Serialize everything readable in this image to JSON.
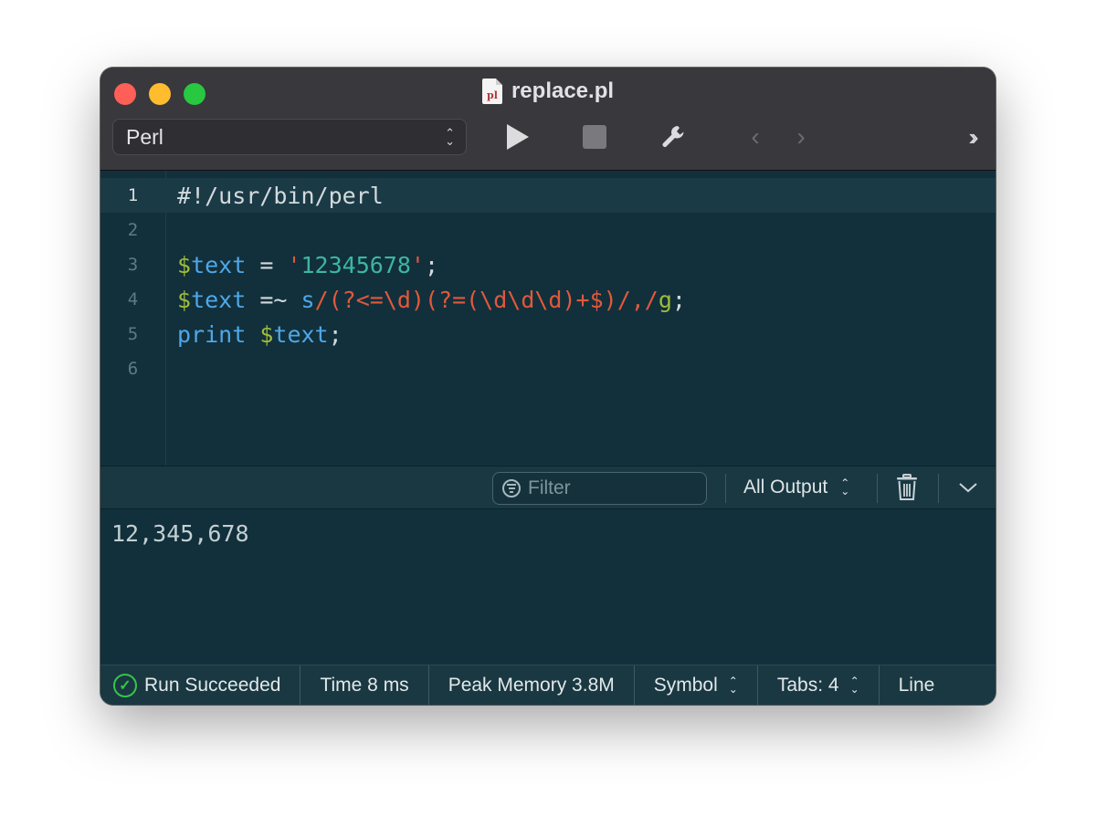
{
  "window": {
    "title": "replace.pl",
    "file_icon_label": "pl"
  },
  "toolbar": {
    "language": "Perl",
    "run_icon": "play-icon",
    "stop_icon": "stop-icon",
    "settings_icon": "wrench-icon",
    "back_icon": "chevron-left-icon",
    "forward_icon": "chevron-right-icon",
    "more_icon": "double-chevron-right-icon"
  },
  "editor": {
    "active_line": 1,
    "lines": [
      {
        "number": "1",
        "tokens": [
          {
            "text": "#!/usr/bin/perl",
            "kind": "default"
          }
        ]
      },
      {
        "number": "2",
        "tokens": []
      },
      {
        "number": "3",
        "tokens": [
          {
            "text": "$",
            "kind": "sigil"
          },
          {
            "text": "text",
            "kind": "var"
          },
          {
            "text": " = ",
            "kind": "op"
          },
          {
            "text": "'",
            "kind": "str"
          },
          {
            "text": "12345678",
            "kind": "num"
          },
          {
            "text": "'",
            "kind": "str"
          },
          {
            "text": ";",
            "kind": "op"
          }
        ]
      },
      {
        "number": "4",
        "tokens": [
          {
            "text": "$",
            "kind": "sigil"
          },
          {
            "text": "text",
            "kind": "var"
          },
          {
            "text": " =~ ",
            "kind": "op"
          },
          {
            "text": "s",
            "kind": "var"
          },
          {
            "text": "/(?<=\\d)(?=(\\d\\d\\d)+$)/,/",
            "kind": "re"
          },
          {
            "text": "g",
            "kind": "reflag"
          },
          {
            "text": ";",
            "kind": "op"
          }
        ]
      },
      {
        "number": "5",
        "tokens": [
          {
            "text": "print",
            "kind": "kw"
          },
          {
            "text": " ",
            "kind": "op"
          },
          {
            "text": "$",
            "kind": "sigil"
          },
          {
            "text": "text",
            "kind": "var"
          },
          {
            "text": ";",
            "kind": "op"
          }
        ]
      },
      {
        "number": "6",
        "tokens": []
      }
    ]
  },
  "output_bar": {
    "filter_placeholder": "Filter",
    "output_mode": "All Output",
    "trash_icon": "trash-icon",
    "collapse_icon": "chevron-down-icon"
  },
  "output": {
    "text": "12,345,678"
  },
  "status": {
    "run_state": "Run Succeeded",
    "time": "Time 8 ms",
    "peak_memory": "Peak Memory 3.8M",
    "symbol": "Symbol",
    "tabs": "Tabs: 4",
    "line": "Line"
  },
  "colors": {
    "editor_bg": "#11303b",
    "titlebar_bg": "#38383d",
    "success_green": "#39c34a",
    "string_red": "#e2583c",
    "variable_blue": "#4fa7e8",
    "sigil_green": "#9fbc3b",
    "number_teal": "#3eb5a6"
  }
}
